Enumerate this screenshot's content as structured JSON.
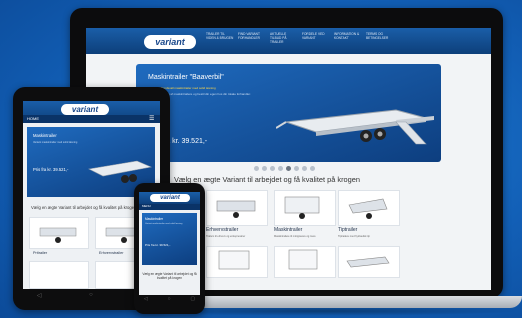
{
  "brand": {
    "logo_text": "variant"
  },
  "laptop": {
    "nav": [
      "TRAILER TIL VIDEN & BRUGEN",
      "FIND VARIANT FORHANDLER",
      "AKTUELLE TILBUD PÅ TRAILER",
      "FORDELE VED VARIANT",
      "INFORMATION & KONTAKT",
      "TERMS OG BETINGELSER"
    ],
    "hero": {
      "title": "Maskintrailer \"Baaverbil\"",
      "subtitle": "Variant – Sundsvall maskintrailer med solid løsning",
      "text": "Se vores udvalg af maskintrailere og bestil din egen hos din lokale forhandler.",
      "price": "Pris fra kr. 39.521,-"
    },
    "slider_dots": 8,
    "active_dot": 4,
    "tagline": "Vælg en ægte Variant til arbejdet og få kvalitet på krogen",
    "products": [
      {
        "label": "Erhvervstrailer",
        "desc": "Trailers til erhverv og entreprenører"
      },
      {
        "label": "Maskintrailer",
        "desc": "Maskintrailere til minigravere og mere"
      },
      {
        "label": "Tiptrailer",
        "desc": "Tiptrailere med hydraulisk tip"
      }
    ]
  },
  "tablet": {
    "nav_home": "HOME",
    "menu_icon": "☰",
    "hero": {
      "title": "Maskintrailer",
      "text": "Variant maskintrailer med solid løsning",
      "price": "Pris fra kr. 39.521,-"
    },
    "tagline": "Vælg en ægte Variant til arbejdet og få kvalitet på krogen",
    "products": [
      {
        "label": "Pritrailer"
      },
      {
        "label": "Erhvervstrailer"
      }
    ],
    "buttons": [
      "◁",
      "○",
      "▢"
    ]
  },
  "phone": {
    "nav_home": "MENU",
    "hero": {
      "title": "Maskintrailer",
      "text": "Variant maskintrailer med solid løsning",
      "price": "Pris fra kr. 39.521,-"
    },
    "tagline": "Vælg en ægte Variant til arbejdet og få kvalitet på krogen",
    "buttons": [
      "◁",
      "○",
      "▢"
    ]
  },
  "colors": {
    "background": "#1460b8",
    "header": "#0d3f7a",
    "hero": "#1f6bbf",
    "accent": "#ffd84a"
  }
}
